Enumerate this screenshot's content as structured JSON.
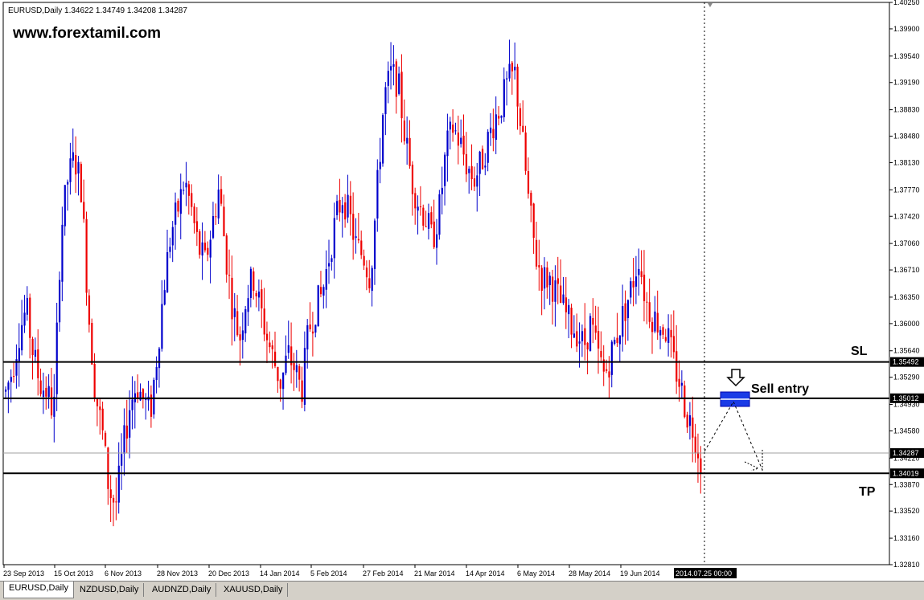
{
  "chart_data": {
    "type": "candlestick",
    "symbol_info": "EURUSD,Daily  1.34622 1.34749 1.34208 1.34287",
    "watermark": "www.forextamil.com",
    "ylim": [
      1.3281,
      1.4025
    ],
    "price_ticks": [
      "1.40250",
      "1.39900",
      "1.39540",
      "1.39190",
      "1.38830",
      "1.38480",
      "1.38130",
      "1.37770",
      "1.37420",
      "1.37060",
      "1.36710",
      "1.36350",
      "1.36000",
      "1.35640",
      "1.35290",
      "1.34930",
      "1.34580",
      "1.34220",
      "1.33870",
      "1.33520",
      "1.33160",
      "1.32810"
    ],
    "date_ticks": [
      "23 Sep 2013",
      "15 Oct 2013",
      "6 Nov 2013",
      "28 Nov 2013",
      "20 Dec 2013",
      "14 Jan 2014",
      "5 Feb 2014",
      "27 Feb 2014",
      "21 Mar 2014",
      "14 Apr 2014",
      "6 May 2014",
      "28 May 2014",
      "19 Jun 2014"
    ],
    "cursor_date": "2014.07.25 00:00",
    "levels": [
      {
        "name": "SL",
        "label": "1.35492",
        "price": 1.35492
      },
      {
        "name": "entry",
        "label": "1.35012",
        "price": 1.35012
      },
      {
        "name": "current",
        "label": "1.34287",
        "price": 1.34287
      },
      {
        "name": "TP",
        "label": "1.34019",
        "price": 1.34019
      }
    ],
    "annotations": {
      "sl": "SL",
      "tp": "TP",
      "sell": "Sell entry"
    },
    "bull_color": "#0000cc",
    "bear_color": "#ee0000",
    "path": [
      1.351,
      1.354,
      1.359,
      1.362,
      1.356,
      1.352,
      1.351,
      1.348,
      1.372,
      1.379,
      1.382,
      1.378,
      1.362,
      1.351,
      1.346,
      1.338,
      1.336,
      1.343,
      1.349,
      1.352,
      1.35,
      1.348,
      1.356,
      1.365,
      1.372,
      1.375,
      1.379,
      1.375,
      1.37,
      1.368,
      1.373,
      1.378,
      1.369,
      1.362,
      1.358,
      1.364,
      1.366,
      1.362,
      1.358,
      1.355,
      1.352,
      1.356,
      1.354,
      1.351,
      1.359,
      1.362,
      1.364,
      1.369,
      1.374,
      1.377,
      1.374,
      1.37,
      1.369,
      1.366,
      1.378,
      1.39,
      1.393,
      1.392,
      1.385,
      1.379,
      1.376,
      1.374,
      1.371,
      1.375,
      1.383,
      1.386,
      1.384,
      1.381,
      1.379,
      1.381,
      1.384,
      1.387,
      1.389,
      1.392,
      1.393,
      1.385,
      1.376,
      1.369,
      1.366,
      1.366,
      1.364,
      1.362,
      1.36,
      1.359,
      1.357,
      1.36,
      1.356,
      1.353,
      1.356,
      1.359,
      1.362,
      1.365,
      1.369,
      1.363,
      1.361,
      1.36,
      1.359,
      1.355,
      1.352,
      1.348,
      1.346,
      1.342
    ]
  },
  "tabs": [
    {
      "label": "EURUSD,Daily"
    },
    {
      "label": "NZDUSD,Daily"
    },
    {
      "label": "AUDNZD,Daily"
    },
    {
      "label": "XAUUSD,Daily"
    }
  ]
}
